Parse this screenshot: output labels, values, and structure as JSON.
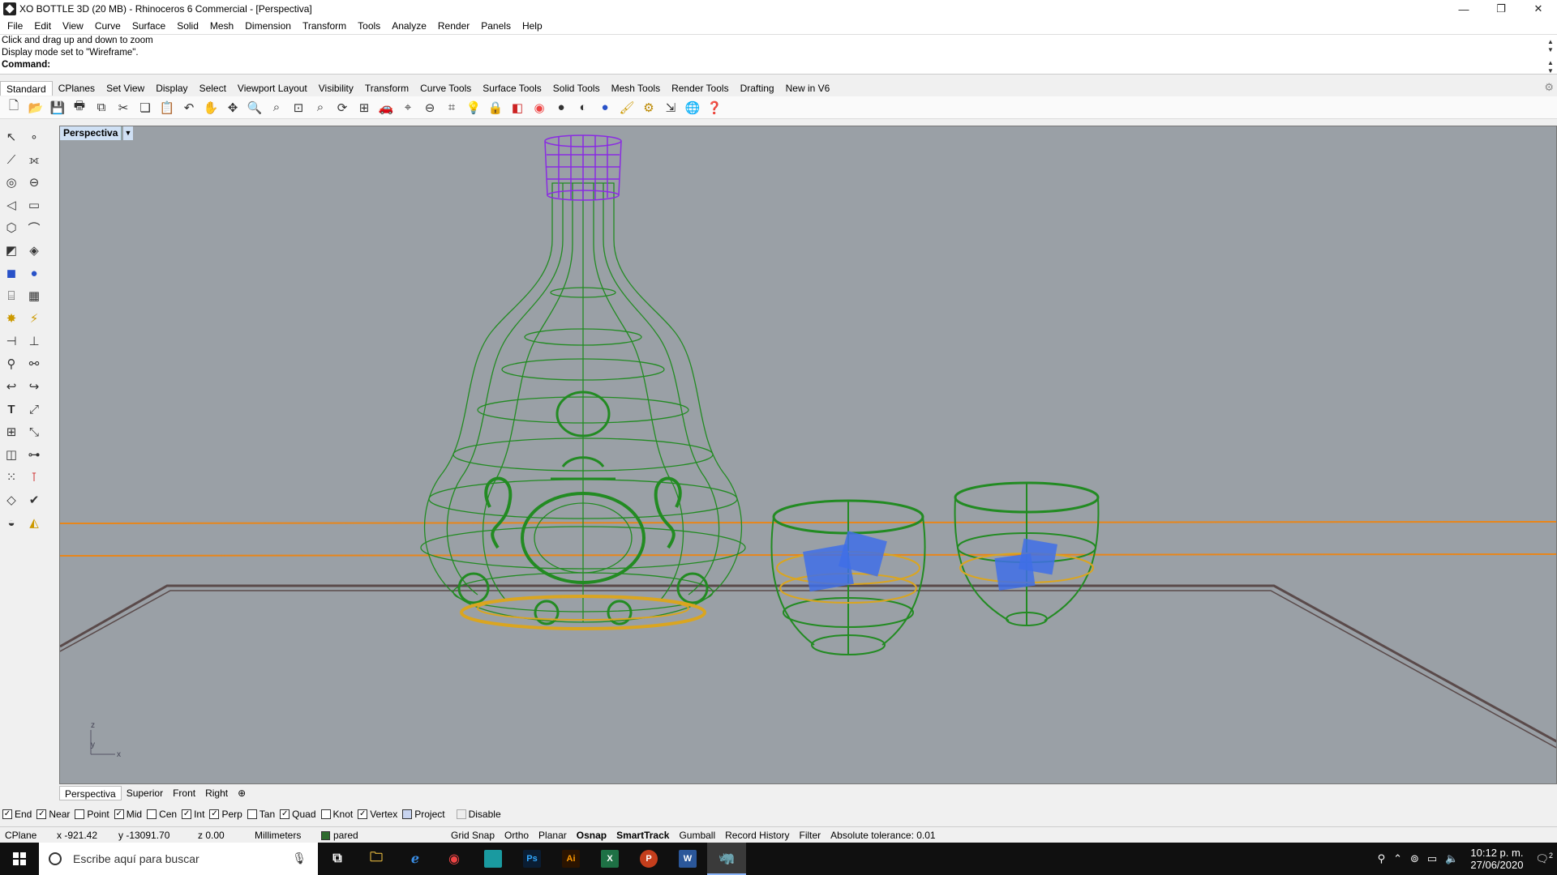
{
  "window": {
    "title": "XO BOTTLE 3D (20 MB) - Rhinoceros 6 Commercial - [Perspectiva]",
    "controls": [
      "—",
      "❐",
      "✕"
    ]
  },
  "menu": [
    "File",
    "Edit",
    "View",
    "Curve",
    "Surface",
    "Solid",
    "Mesh",
    "Dimension",
    "Transform",
    "Tools",
    "Analyze",
    "Render",
    "Panels",
    "Help"
  ],
  "command": {
    "history_1": "Click and drag up and down to zoom",
    "history_2": "Display mode set to \"Wireframe\".",
    "prompt": "Command:"
  },
  "toolbar_tabs": [
    "Standard",
    "CPlanes",
    "Set View",
    "Display",
    "Select",
    "Viewport Layout",
    "Visibility",
    "Transform",
    "Curve Tools",
    "Surface Tools",
    "Solid Tools",
    "Mesh Tools",
    "Render Tools",
    "Drafting",
    "New in V6"
  ],
  "toolbar_icons": [
    "new-file",
    "open",
    "save",
    "print",
    "import",
    "cut",
    "copy",
    "paste",
    "undo",
    "pan",
    "rotate",
    "zoom-window",
    "zoom-dynamic",
    "zoom-extents",
    "zoom-selected",
    "rotate-view",
    "four-views",
    "car",
    "cplane",
    "set-cplane",
    "osnap",
    "light",
    "lock",
    "layers",
    "properties-color",
    "sphere",
    "render-sphere",
    "render-blue",
    "brush",
    "gear-settings",
    "pointer-tools",
    "globe",
    "help"
  ],
  "left_tools": [
    "select-arrow",
    "point",
    "polyline",
    "control-points",
    "circle",
    "ellipse",
    "arc",
    "rectangle",
    "polygon",
    "curve-fillet",
    "surface-corner",
    "extrude",
    "box",
    "boolean",
    "cylinder",
    "mesh",
    "explode",
    "split",
    "trim",
    "join",
    "extrude-curve",
    "blend",
    "fillet",
    "offset",
    "text",
    "move",
    "array",
    "scale",
    "solid-box",
    "dimension",
    "grid-array",
    "ruler",
    "loft",
    "check",
    "material",
    "paint"
  ],
  "viewport": {
    "label": "Perspectiva",
    "axis_labels": {
      "z": "z",
      "y": "y",
      "x": "x"
    },
    "colors": {
      "background": "#9aa0a6",
      "bottle": "#228b22",
      "cap": "#8a2be2",
      "liquid": "#daa520",
      "ice": "#3f6ee8",
      "table": "#5a4a4a",
      "horizon": "#e8861a"
    }
  },
  "viewport_tabs": [
    "Perspectiva",
    "Superior",
    "Front",
    "Right"
  ],
  "osnaps": [
    {
      "label": "End",
      "checked": true
    },
    {
      "label": "Near",
      "checked": true
    },
    {
      "label": "Point",
      "checked": false
    },
    {
      "label": "Mid",
      "checked": true
    },
    {
      "label": "Cen",
      "checked": false
    },
    {
      "label": "Int",
      "checked": true
    },
    {
      "label": "Perp",
      "checked": true
    },
    {
      "label": "Tan",
      "checked": false
    },
    {
      "label": "Quad",
      "checked": true
    },
    {
      "label": "Knot",
      "checked": false
    },
    {
      "label": "Vertex",
      "checked": true
    },
    {
      "label": "Project",
      "checked": false
    },
    {
      "label": "Disable",
      "checked": false
    }
  ],
  "status": {
    "cplane": "CPlane",
    "x": "x -921.42",
    "y": "y -13091.70",
    "z": "z 0.00",
    "units": "Millimeters",
    "layer": "pared",
    "grid_snap": "Grid Snap",
    "ortho": "Ortho",
    "planar": "Planar",
    "osnap": "Osnap",
    "smarttrack": "SmartTrack",
    "gumball": "Gumball",
    "record_history": "Record History",
    "filter": "Filter",
    "tolerance": "Absolute tolerance: 0.01"
  },
  "taskbar": {
    "search_placeholder": "Escribe aquí para buscar",
    "apps": [
      "task-view",
      "file-explorer",
      "edge",
      "chrome",
      "app-teal",
      "photoshop",
      "illustrator",
      "excel",
      "powerpoint",
      "word",
      "rhino"
    ],
    "app_labels": {
      "photoshop": "Ps",
      "illustrator": "Ai",
      "excel": "X",
      "powerpoint": "P",
      "word": "W"
    },
    "time": "10:12 p. m.",
    "date": "27/06/2020",
    "notifications": "2"
  }
}
